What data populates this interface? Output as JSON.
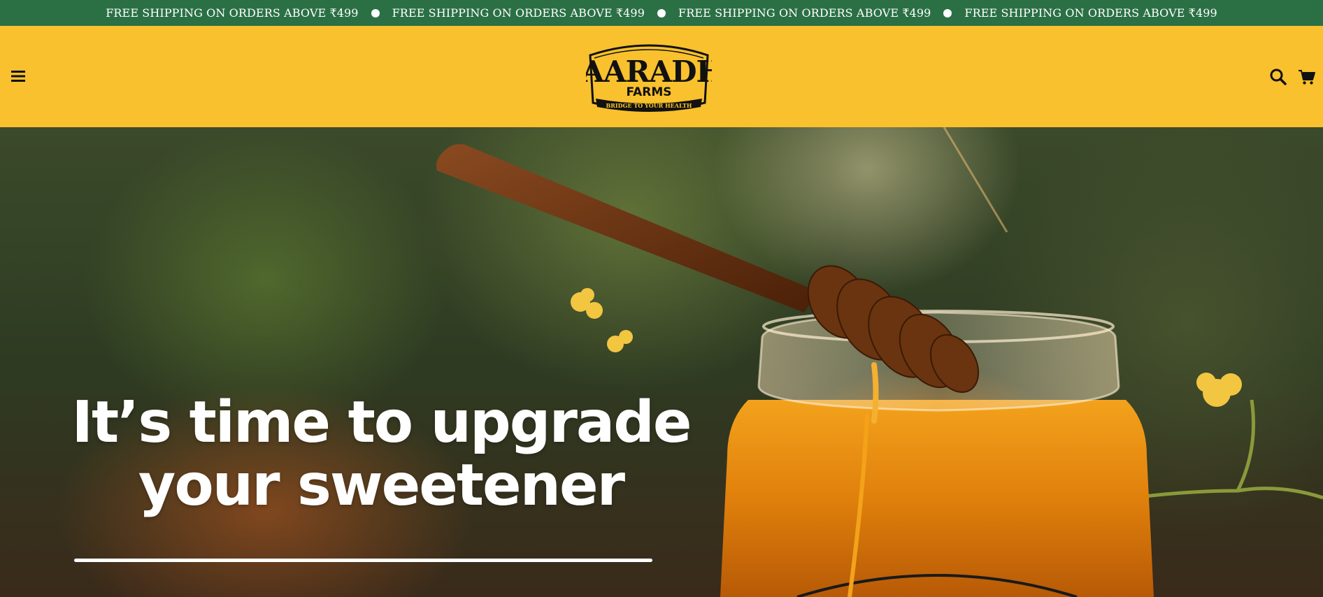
{
  "announcement": {
    "messages": [
      "FREE SHIPPING ON ORDERS ABOVE ₹499",
      "FREE SHIPPING ON ORDERS ABOVE ₹499",
      "FREE SHIPPING ON ORDERS ABOVE ₹499",
      "FREE SHIPPING ON ORDERS ABOVE ₹499"
    ]
  },
  "header": {
    "menu_icon": "hamburger-menu-icon",
    "search_icon": "search-icon",
    "cart_icon": "cart-icon",
    "logo": {
      "brand": "VAARADHI",
      "sub": "FARMS",
      "tagline": "BRIDGE TO YOUR HEALTH"
    }
  },
  "hero": {
    "title_line1": "It’s time to upgrade",
    "title_line2": "your sweetener"
  },
  "colors": {
    "announcement_bg": "#2b7045",
    "header_bg": "#f8c12d",
    "text_dark": "#111111",
    "hero_text": "#ffffff"
  }
}
